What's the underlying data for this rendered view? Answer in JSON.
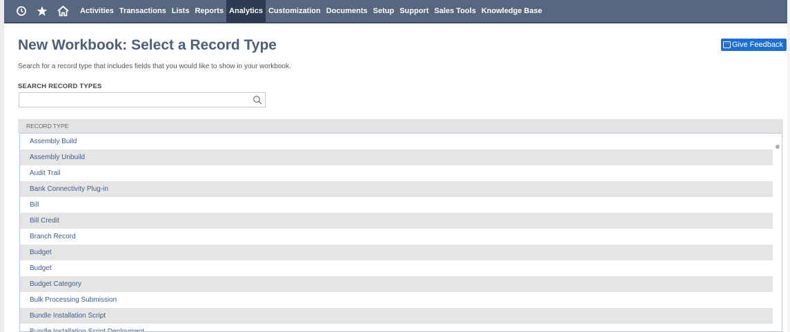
{
  "navbar": {
    "icons": [
      "history-icon",
      "star-icon",
      "home-icon"
    ],
    "items": [
      "Activities",
      "Transactions",
      "Lists",
      "Reports",
      "Analytics",
      "Customization",
      "Documents",
      "Setup",
      "Support",
      "Sales Tools",
      "Knowledge Base"
    ],
    "active": "Analytics"
  },
  "page": {
    "title": "New Workbook: Select a Record Type",
    "subtitle": "Search for a record type that includes fields that you would like to show in your workbook.",
    "feedback_label": "Give Feedback"
  },
  "search": {
    "label": "SEARCH RECORD TYPES",
    "value": "",
    "placeholder": ""
  },
  "table": {
    "header": "RECORD TYPE",
    "rows": [
      "Assembly Build",
      "Assembly Unbuild",
      "Audit Trail",
      "Bank Connectivity Plug-in",
      "Bill",
      "Bill Credit",
      "Branch Record",
      "Budget",
      "Budget",
      "Budget Category",
      "Bulk Processing Submission",
      "Bundle Installation Script",
      "Bundle Installation Script Deployment"
    ]
  },
  "colors": {
    "navbar": "#56677f",
    "nav_active": "#2d3c52",
    "title": "#4d5f79",
    "link": "#3d5d88",
    "accent": "#1a6ed8"
  }
}
